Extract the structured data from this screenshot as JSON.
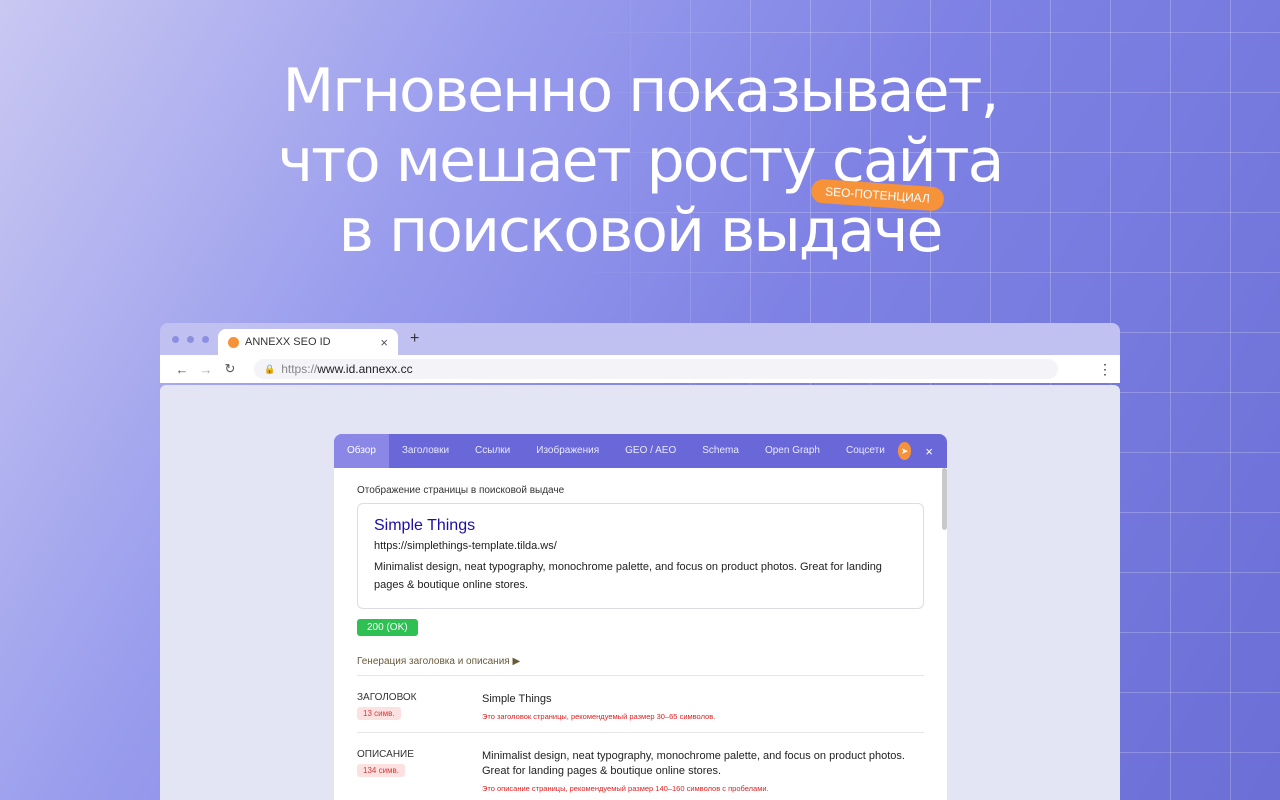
{
  "headline": {
    "line1": "Мгновенно показывает,",
    "line2": "что мешает росту сайта",
    "line3": "в поисковой выдаче",
    "tag": "SEO-ПОТЕНЦИАЛ"
  },
  "browser": {
    "tab_title": "ANNEXX SEO ID",
    "tab_close": "×",
    "new_tab": "+",
    "url_protocol": "https://",
    "url_host": "www.id.annexx.cc"
  },
  "panel": {
    "tabs": [
      "Обзор",
      "Заголовки",
      "Ссылки",
      "Изображения",
      "GEO / AEO",
      "Schema",
      "Open Graph",
      "Соцсети"
    ],
    "close": "×",
    "section_title": "Отображение страницы в поисковой выдаче",
    "serp": {
      "title": "Simple Things",
      "url": "https://simplethings-template.tilda.ws/",
      "description": "Minimalist design, neat typography, monochrome palette, and focus on product photos. Great for landing pages & boutique online stores."
    },
    "status": "200 (OK)",
    "generation_label": "Генерация заголовка и описания  ▶",
    "rows": [
      {
        "label": "ЗАГОЛОВОК",
        "badge": "13 симв.",
        "value": "Simple Things",
        "hint": "Это заголовок страницы, рекомендуемый размер 30–65 символов."
      },
      {
        "label": "ОПИСАНИЕ",
        "badge": "134 симв.",
        "value": "Minimalist design, neat typography, monochrome palette, and focus on product photos. Great for landing pages & boutique online stores.",
        "hint": "Это описание страницы, рекомендуемый размер 140–160 символов с пробелами."
      }
    ]
  },
  "colors": {
    "accent": "#6a67d8",
    "orange": "#f6923a",
    "ok_green": "#2ec053",
    "serp_link": "#1a0dab"
  }
}
